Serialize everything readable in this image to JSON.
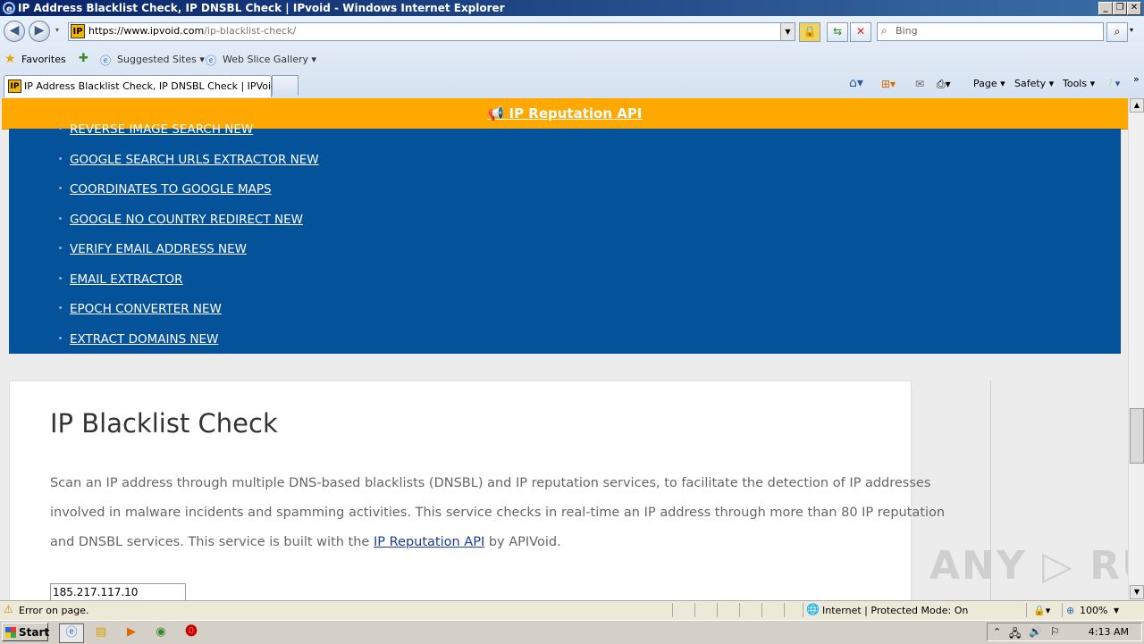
{
  "window": {
    "title": "IP Address Blacklist Check, IP DNSBL Check | IPvoid - Windows Internet Explorer",
    "controls": [
      "_",
      "❐",
      "✕"
    ]
  },
  "toolbar": {
    "url_host": "https://www.ipvoid.com",
    "url_path": "/ip-blacklist-check/",
    "search_placeholder": "Bing",
    "fav_icon_text": "IP"
  },
  "favorites_bar": {
    "favorites_label": "Favorites",
    "suggested_sites_label": "Suggested Sites ▾",
    "web_slice_label": "Web Slice Gallery ▾"
  },
  "tab": {
    "label": "IP Address Blacklist Check, IP DNSBL Check | IPVoid"
  },
  "command_bar": {
    "page_label": "Page ▾",
    "safety_label": "Safety ▾",
    "tools_label": "Tools ▾",
    "help_label": "❔▾"
  },
  "page": {
    "promo_label": "IP Reputation API",
    "menu_items": [
      "REVERSE IMAGE SEARCH NEW",
      "GOOGLE SEARCH URLS EXTRACTOR NEW",
      "COORDINATES TO GOOGLE MAPS",
      "GOOGLE NO COUNTRY REDIRECT NEW",
      "VERIFY EMAIL ADDRESS NEW",
      "EMAIL EXTRACTOR",
      "EPOCH CONVERTER NEW",
      "EXTRACT DOMAINS NEW"
    ],
    "heading": "IP Blacklist Check",
    "desc_part1": "Scan an IP address through multiple DNS-based blacklists (DNSBL) and IP reputation services, to facilitate the detection of IP addresses involved in malware incidents and spamming activities. This service checks in real-time an IP address through more than 80 IP reputation and DNSBL services. This service is built with the ",
    "desc_link": "IP Reputation API",
    "desc_part2": " by APIVoid.",
    "ip_value": "185.217.117.10",
    "watermark": "ANY ▷ RUN"
  },
  "status_bar": {
    "message": "Error on page.",
    "zone": "Internet | Protected Mode: On",
    "zoom": "100%"
  },
  "taskbar": {
    "start_label": "Start",
    "clock": "4:13 AM"
  }
}
